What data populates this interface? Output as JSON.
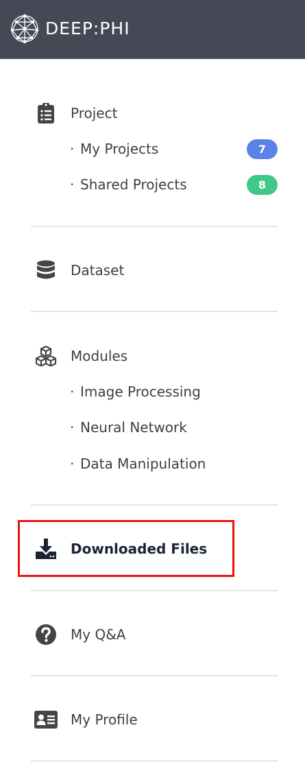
{
  "brand": {
    "name": "DEEP:PHI",
    "logo_icon": "network-globe-icon"
  },
  "colors": {
    "topbar": "#454955",
    "badge_my_projects": "#5b82e8",
    "badge_shared_projects": "#3fc989",
    "highlight": "#ee1111",
    "active_text": "#1a2233"
  },
  "menu": {
    "project": {
      "label": "Project",
      "icon": "clipboard-list-icon",
      "items": [
        {
          "label": "My Projects",
          "bullet": "·",
          "badge": "7"
        },
        {
          "label": "Shared Projects",
          "bullet": "·",
          "badge": "8"
        }
      ]
    },
    "dataset": {
      "label": "Dataset",
      "icon": "database-icon"
    },
    "modules": {
      "label": "Modules",
      "icon": "cubes-icon",
      "items": [
        {
          "label": "Image Processing",
          "bullet": "·"
        },
        {
          "label": "Neural Network",
          "bullet": "·"
        },
        {
          "label": "Data Manipulation",
          "bullet": "·"
        }
      ]
    },
    "downloaded_files": {
      "label": "Downloaded Files",
      "icon": "download-icon",
      "active": true
    },
    "my_qa": {
      "label": "My Q&A",
      "icon": "question-circle-icon"
    },
    "my_profile": {
      "label": "My Profile",
      "icon": "id-card-icon"
    }
  }
}
